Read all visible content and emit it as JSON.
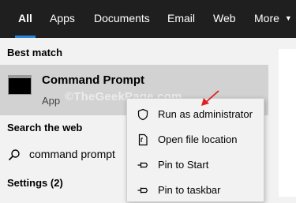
{
  "tabs": [
    {
      "label": "All",
      "active": true
    },
    {
      "label": "Apps"
    },
    {
      "label": "Documents"
    },
    {
      "label": "Email"
    },
    {
      "label": "Web"
    },
    {
      "label": "More",
      "icon": "chevron-down-icon"
    }
  ],
  "best_match": {
    "header": "Best match",
    "title": "Command Prompt",
    "subtitle": "App",
    "icon": "command-prompt-icon"
  },
  "search_web": {
    "header": "Search the web",
    "query": "command prompt",
    "icon": "search-icon"
  },
  "settings": {
    "header": "Settings (2)"
  },
  "context_menu": {
    "items": [
      {
        "label": "Run as administrator",
        "icon": "shield-icon"
      },
      {
        "label": "Open file location",
        "icon": "file-icon"
      },
      {
        "label": "Pin to Start",
        "icon": "pin-icon"
      },
      {
        "label": "Pin to taskbar",
        "icon": "pin-icon"
      }
    ]
  },
  "watermark": "©TheGeekPage.com",
  "colors": {
    "topbar": "#1f1f1f",
    "accent": "#2b88d8",
    "selected_row": "#d2d2d2",
    "pane": "#f2f2f2",
    "annotation": "#e02020"
  }
}
